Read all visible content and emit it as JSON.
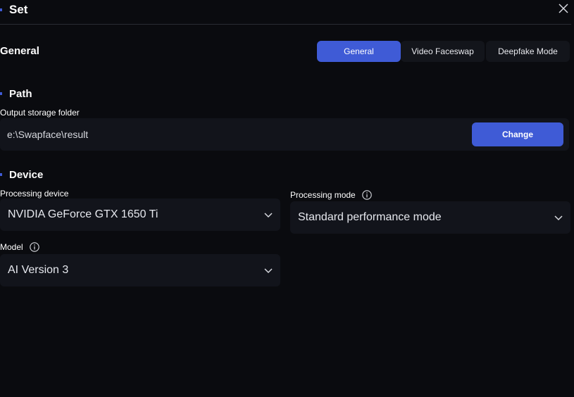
{
  "header": {
    "title": "Set",
    "close_icon": "close-icon"
  },
  "general": {
    "label": "General",
    "tabs": [
      {
        "label": "General",
        "active": true
      },
      {
        "label": "Video Faceswap",
        "active": false
      },
      {
        "label": "Deepfake Mode",
        "active": false
      }
    ]
  },
  "path": {
    "title": "Path",
    "output_label": "Output storage folder",
    "output_value": "e:\\Swapface\\result",
    "change_label": "Change"
  },
  "device": {
    "title": "Device",
    "processing_device_label": "Processing device",
    "processing_device_value": "NVIDIA GeForce GTX 1650 Ti",
    "processing_mode_label": "Processing mode",
    "processing_mode_value": "Standard performance mode",
    "model_label": "Model",
    "model_value": "AI Version 3"
  },
  "colors": {
    "background": "#0a0b0f",
    "accent": "#3f5bd6",
    "field_bg": "#12141b"
  }
}
